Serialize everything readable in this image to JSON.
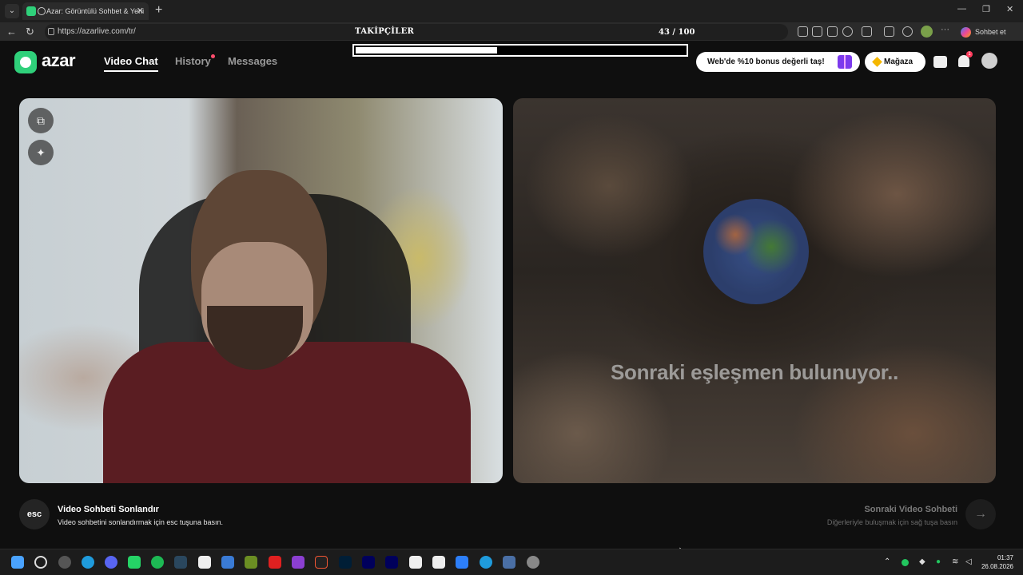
{
  "browser": {
    "tab_title": "Azar: Görüntülü Sohbet & Yeni",
    "url": "https://azarlive.com/tr/",
    "copilot_label": "Sohbet et"
  },
  "overlay": {
    "title": "TAKİPÇİLER",
    "count_text": "43 / 100",
    "current": 43,
    "goal": 100
  },
  "app": {
    "logo_text": "azar",
    "nav": {
      "video_chat": "Video Chat",
      "history": "History",
      "messages": "Messages"
    },
    "bonus_label": "Web'de %10 bonus değerli taş!",
    "shop_label": "Mağaza",
    "notification_count": "1"
  },
  "video": {
    "searching_text": "Sonraki eşleşmen bulunuyor.."
  },
  "footer": {
    "esc_key": "esc",
    "end_title": "Video Sohbeti Sonlandır",
    "end_desc": "Video sohbetini sonlandırmak için esc tuşuna basın.",
    "next_title": "Sonraki Video Sohbeti",
    "next_desc": "Diğerleriyle buluşmak için sağ tuşa basın"
  },
  "taskbar": {
    "time": "01:37",
    "date": "26.08.2026"
  },
  "colors": {
    "brand": "#2fd07a",
    "badge": "#ff3b5c"
  }
}
